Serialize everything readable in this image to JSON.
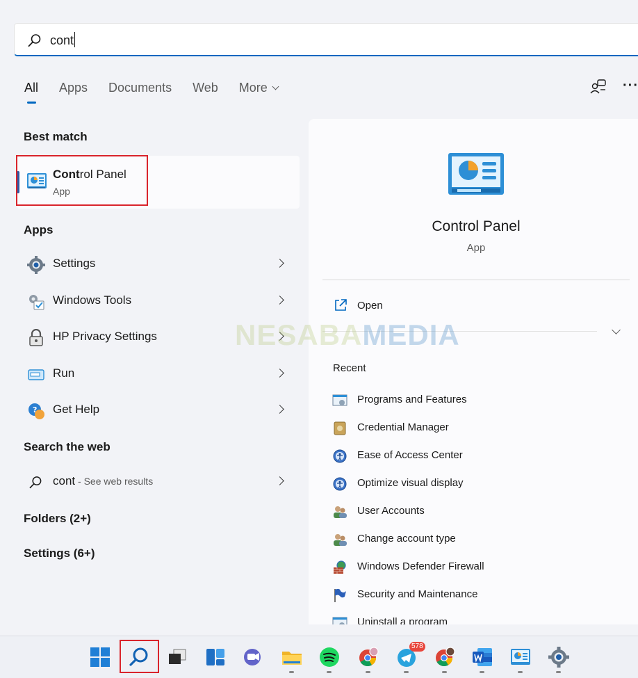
{
  "search": {
    "query": "cont"
  },
  "tabs": [
    {
      "label": "All",
      "active": true
    },
    {
      "label": "Apps",
      "active": false
    },
    {
      "label": "Documents",
      "active": false
    },
    {
      "label": "Web",
      "active": false
    },
    {
      "label": "More",
      "active": false
    }
  ],
  "header_icons": {
    "share": "share-device-icon",
    "more": "···"
  },
  "best_match": {
    "title": "Best match",
    "name_bold": "Cont",
    "name_rest": "rol Panel",
    "type": "App"
  },
  "apps": {
    "title": "Apps",
    "items": [
      {
        "label": "Settings",
        "icon": "settings-gear-icon"
      },
      {
        "label": "Windows Tools",
        "icon": "windows-tools-icon"
      },
      {
        "label": "HP Privacy Settings",
        "icon": "hp-privacy-lock-icon"
      },
      {
        "label": "Run",
        "icon": "run-icon"
      },
      {
        "label": "Get Help",
        "icon": "get-help-icon"
      }
    ]
  },
  "web": {
    "title": "Search the web",
    "query": "cont",
    "suffix": " - See web results"
  },
  "folders": {
    "title": "Folders (2+)"
  },
  "settings_section": {
    "title": "Settings (6+)"
  },
  "detail": {
    "title": "Control Panel",
    "subtitle": "App",
    "open_label": "Open",
    "recent_title": "Recent",
    "recent": [
      {
        "label": "Programs and Features",
        "icon": "programs-features-icon"
      },
      {
        "label": "Credential Manager",
        "icon": "credential-manager-icon"
      },
      {
        "label": "Ease of Access Center",
        "icon": "ease-of-access-icon"
      },
      {
        "label": "Optimize visual display",
        "icon": "ease-of-access-icon"
      },
      {
        "label": "User Accounts",
        "icon": "user-accounts-icon"
      },
      {
        "label": "Change account type",
        "icon": "user-accounts-icon"
      },
      {
        "label": "Windows Defender Firewall",
        "icon": "firewall-icon"
      },
      {
        "label": "Security and Maintenance",
        "icon": "security-flag-icon"
      },
      {
        "label": "Uninstall a program",
        "icon": "programs-features-icon"
      }
    ]
  },
  "watermark": {
    "part1": "NESABA",
    "part2": "MEDIA"
  },
  "taskbar": {
    "telegram_badge": "578",
    "items": [
      "start",
      "search",
      "task-view",
      "widgets",
      "chat",
      "file-explorer",
      "spotify",
      "chrome-profile-1",
      "telegram",
      "chrome-profile-2",
      "word",
      "control-panel",
      "settings"
    ]
  },
  "colors": {
    "accent": "#0067c0",
    "highlight": "#d9242c"
  }
}
